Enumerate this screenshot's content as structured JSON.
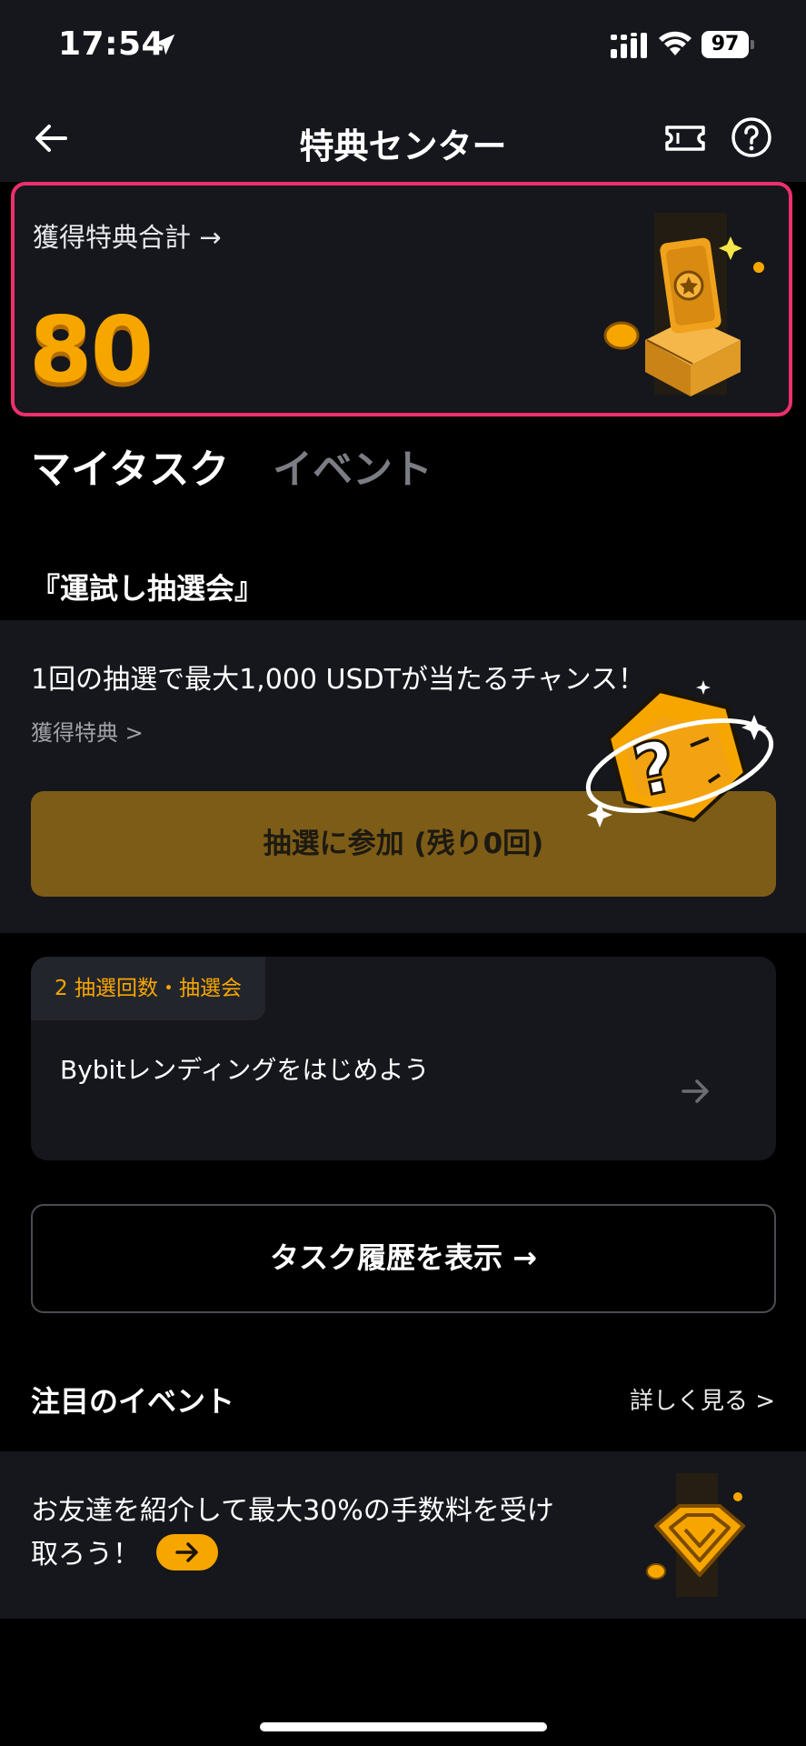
{
  "status_bar": {
    "time": "17:54",
    "battery": "97",
    "icons": [
      "location-arrow-icon",
      "signal-icon",
      "wifi-icon",
      "battery-icon"
    ]
  },
  "header": {
    "title": "特典センター",
    "icons": [
      "back-arrow-icon",
      "ticket-icon",
      "help-icon"
    ]
  },
  "reward_card": {
    "title": "獲得特典合計 →",
    "value": "80"
  },
  "tabs": [
    {
      "label": "マイタスク",
      "active": true
    },
    {
      "label": "イベント",
      "active": false
    }
  ],
  "lottery": {
    "section_title": "『運試し抽選会』",
    "headline": "1回の抽選で最大1,000 USDTが当たるチャンス！",
    "rewards_link": "獲得特典 >",
    "join_button": "抽選に参加 (残り0回)"
  },
  "task": {
    "badge": "2 抽選回数・抽選会",
    "text": "Bybitレンディングをはじめよう"
  },
  "history_button": "タスク履歴を表示 →",
  "events": {
    "section_title": "注目のイベント",
    "more_link": "詳しく見る >"
  },
  "invite": {
    "text": "お友達を紹介して最大30%の手数料を受け取ろう！"
  },
  "colors": {
    "accent": "#f7a600",
    "highlight_border": "#ee2f6e",
    "card_bg": "#16171c",
    "page_bg": "#000000"
  }
}
